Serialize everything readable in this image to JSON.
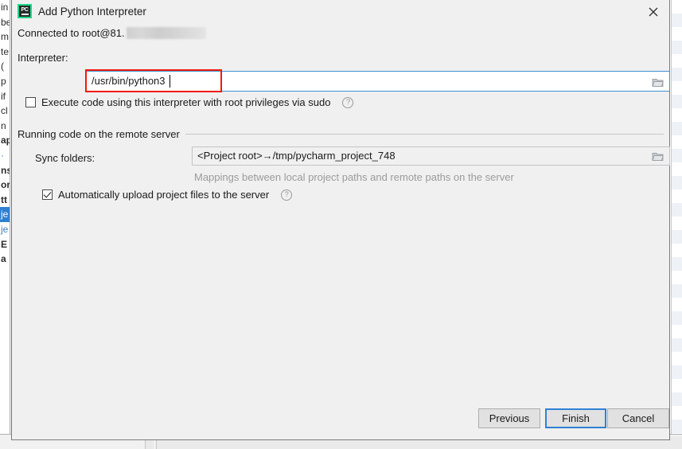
{
  "backdrop": {
    "left_strip_lines": [
      {
        "t": "in",
        "style": "plain"
      },
      {
        "t": "be",
        "style": "plain"
      },
      {
        "t": "m",
        "style": "plain"
      },
      {
        "t": "te",
        "style": "plain"
      },
      {
        "t": "(",
        "style": "plain"
      },
      {
        "t": "p",
        "style": "plain"
      },
      {
        "t": "if",
        "style": "plain"
      },
      {
        "t": "cl",
        "style": "plain"
      },
      {
        "t": "n",
        "style": "plain"
      },
      {
        "t": "ap",
        "style": "bold"
      },
      {
        "t": "·",
        "style": "blue"
      },
      {
        "t": "ns",
        "style": "bold"
      },
      {
        "t": "or",
        "style": "bold"
      },
      {
        "t": "tt",
        "style": "bold"
      },
      {
        "t": "je",
        "style": "selected"
      },
      {
        "t": "je",
        "style": "blue"
      },
      {
        "t": "E",
        "style": "bold"
      },
      {
        "t": "a",
        "style": "bold"
      }
    ]
  },
  "dialog": {
    "title": "Add Python Interpreter",
    "icon": "pycharm-icon",
    "close_icon": "close-icon",
    "connection": {
      "prefix": "Connected to root@81.",
      "redacted": true
    },
    "interpreter": {
      "label": "Interpreter:",
      "value": "/usr/bin/python3",
      "browse_icon": "folder-icon",
      "focused": true,
      "highlight_color": "#f01a0d"
    },
    "sudo": {
      "label": "Execute code using this interpreter with root privileges via sudo",
      "checked": false,
      "help_icon": "help-icon",
      "help_glyph": "?"
    },
    "remote_section": {
      "title": "Running code on the remote server",
      "sync_folders": {
        "label": "Sync folders:",
        "value": "<Project root>→/tmp/pycharm_project_748",
        "browse_icon": "folder-icon"
      },
      "hint": "Mappings between local project paths and remote paths on the server",
      "auto_upload": {
        "label": "Automatically upload project files to the server",
        "checked": true,
        "help_icon": "help-icon",
        "help_glyph": "?"
      }
    },
    "footer": {
      "previous_label": "Previous",
      "finish_label": "Finish",
      "cancel_label": "Cancel",
      "default_button": "Finish",
      "focus_color": "#2f81d6"
    }
  }
}
